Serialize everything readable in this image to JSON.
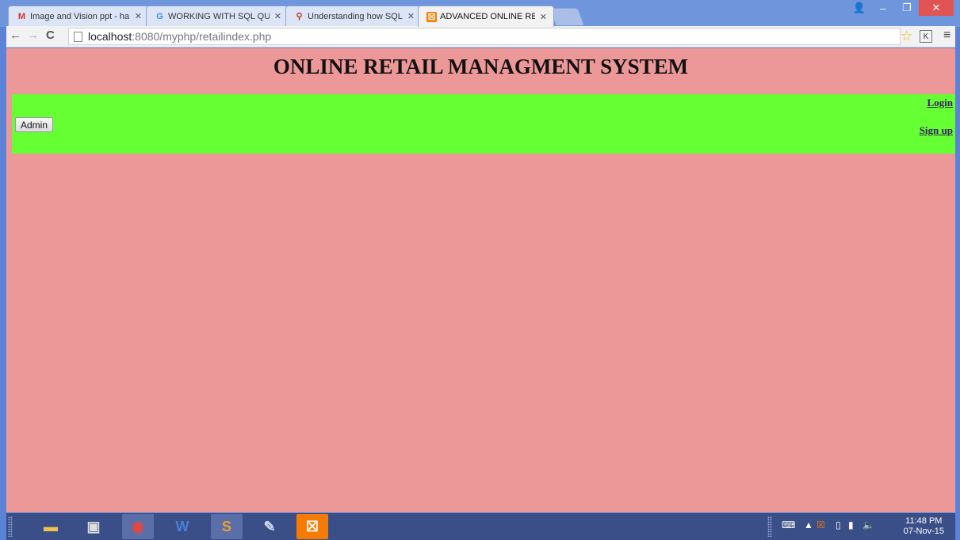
{
  "browser": {
    "tabs": [
      {
        "title": "Image and Vision ppt - ha",
        "icon": "gmail-icon",
        "icon_glyph": "M",
        "icon_color": "#d93025"
      },
      {
        "title": "WORKING WITH SQL QUE",
        "icon": "google-icon",
        "icon_glyph": "G",
        "icon_color": "#4285f4"
      },
      {
        "title": "Understanding how SQL S",
        "icon": "sql-icon",
        "icon_glyph": "⚲",
        "icon_color": "#c0392b"
      },
      {
        "title": "ADVANCED ONLINE RETA",
        "icon": "xampp-icon",
        "icon_glyph": "☒",
        "icon_color": "#f57c00"
      }
    ],
    "url_host": "localhost",
    "url_path": ":8080/myphp/retailindex.php"
  },
  "page": {
    "title": "ONLINE RETAIL MANAGMENT SYSTEM",
    "admin_label": "Admin",
    "login_label": "Login",
    "signup_label": "Sign up",
    "background_color": "#ec9898",
    "bar_color": "#66ff33"
  },
  "taskbar": {
    "apps": [
      "file-explorer-icon",
      "terminal-icon",
      "chrome-icon",
      "word-icon",
      "sublime-icon",
      "paint-icon",
      "xampp-icon"
    ],
    "time": "11:48 PM",
    "date": "07-Nov-15"
  }
}
